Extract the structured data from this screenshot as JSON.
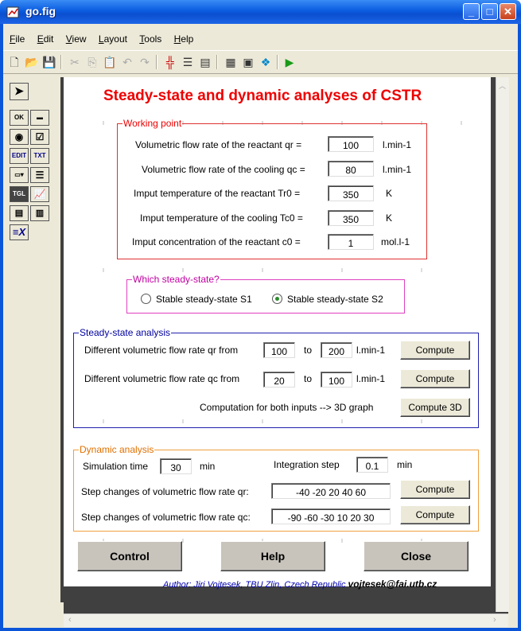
{
  "window": {
    "title": "go.fig"
  },
  "menu": [
    {
      "label": "File",
      "u": "F",
      "rest": "ile"
    },
    {
      "label": "Edit",
      "u": "E",
      "rest": "dit"
    },
    {
      "label": "View",
      "u": "V",
      "rest": "iew"
    },
    {
      "label": "Layout",
      "u": "L",
      "rest": "ayout"
    },
    {
      "label": "Tools",
      "u": "T",
      "rest": "ools"
    },
    {
      "label": "Help",
      "u": "H",
      "rest": "elp"
    }
  ],
  "heading": "Steady-state and dynamic analyses of CSTR",
  "working_point": {
    "title": "Working point",
    "rows": [
      {
        "label": "Volumetric flow rate of the reactant qr =",
        "value": "100",
        "unit": "l.min-1"
      },
      {
        "label": "Volumetric flow rate of the cooling qc =",
        "value": "80",
        "unit": "l.min-1"
      },
      {
        "label": "Imput temperature of the reactant Tr0 =",
        "value": "350",
        "unit": "K"
      },
      {
        "label": "Imput temperature of the cooling Tc0 =",
        "value": "350",
        "unit": "K"
      },
      {
        "label": "Imput concentration of the reactant c0 =",
        "value": "1",
        "unit": "mol.l-1"
      }
    ]
  },
  "steady_state_choice": {
    "title": "Which steady-state?",
    "option1": "Stable steady-state S1",
    "option2": "Stable steady-state S2",
    "selected": "option2"
  },
  "steady_state_analysis": {
    "title": "Steady-state analysis",
    "qr": {
      "label": "Different volumetric flow rate qr from",
      "from": "100",
      "to_label": "to",
      "to": "200",
      "unit": "l.min-1",
      "button": "Compute"
    },
    "qc": {
      "label": "Different volumetric flow rate qc from",
      "from": "20",
      "to_label": "to",
      "to": "100",
      "unit": "l.min-1",
      "button": "Compute"
    },
    "both_label": "Computation for both inputs --> 3D graph",
    "button_3d": "Compute 3D"
  },
  "dynamic_analysis": {
    "title": "Dynamic analysis",
    "sim_label": "Simulation time",
    "sim_value": "30",
    "sim_unit": "min",
    "int_label": "Integration step",
    "int_value": "0.1",
    "int_unit": "min",
    "qr_label": "Step changes of volumetric flow rate qr:",
    "qr_value": "-40 -20 20 40 60",
    "qc_label": "Step changes of volumetric flow rate qc:",
    "qc_value": "-90 -60 -30 10 20 30",
    "button": "Compute"
  },
  "buttons": {
    "control": "Control",
    "help": "Help",
    "close": "Close"
  },
  "author": {
    "text": "Author: Jiri Vojtesek, TBU Zlin, Czech Republic ",
    "email": "vojtesek@fai.utb.cz"
  },
  "palette": [
    "select",
    "OK",
    "slider",
    "radio",
    "check",
    "EDIT",
    "TXT",
    "popup",
    "listbox",
    "TGL",
    "axes",
    "frame",
    "panel",
    "activex"
  ],
  "colors": {
    "accent": "#e00000",
    "wp_border": "#e03030",
    "choice_border": "#e040c0",
    "ss_border": "#2020b0",
    "dyn_border": "#f0a040"
  }
}
